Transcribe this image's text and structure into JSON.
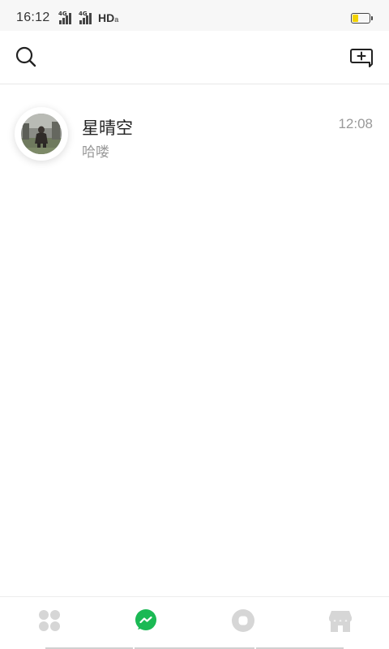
{
  "status_bar": {
    "time": "16:12",
    "network_1": "4G",
    "network_2": "4G",
    "hd_label": "HD",
    "hd_sub": "a",
    "battery_level": 0.35,
    "battery_color": "#f2d200"
  },
  "toolbar": {
    "search_icon": "search-icon",
    "compose_icon": "new-chat-icon"
  },
  "conversations": [
    {
      "name": "星晴空",
      "last_message": "哈喽",
      "time": "12:08",
      "avatar": "photo-avatar"
    }
  ],
  "bottom_nav": {
    "items": [
      {
        "icon": "apps-grid-icon",
        "active": false
      },
      {
        "icon": "messages-icon",
        "active": true
      },
      {
        "icon": "moments-icon",
        "active": false
      },
      {
        "icon": "store-icon",
        "active": false
      }
    ],
    "active_color": "#1bb954",
    "inactive_color": "#d6d6d6"
  }
}
